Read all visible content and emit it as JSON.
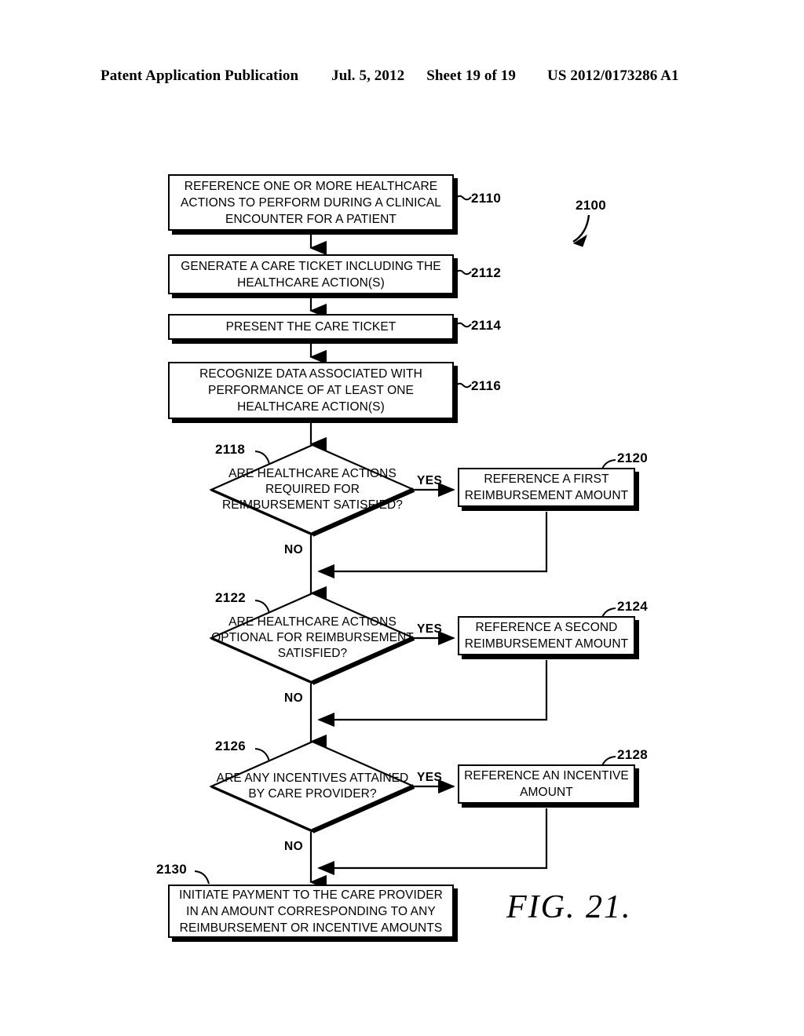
{
  "header": {
    "publication": "Patent Application Publication",
    "date": "Jul. 5, 2012",
    "sheet": "Sheet 19 of 19",
    "number": "US 2012/0173286 A1"
  },
  "figure": {
    "caption": "FIG. 21.",
    "overall_ref": "2100"
  },
  "nodes": {
    "n2110": {
      "ref": "2110",
      "text": "REFERENCE ONE OR MORE HEALTHCARE ACTIONS TO PERFORM DURING A CLINICAL ENCOUNTER FOR A PATIENT"
    },
    "n2112": {
      "ref": "2112",
      "text": "GENERATE A CARE TICKET INCLUDING THE HEALTHCARE ACTION(S)"
    },
    "n2114": {
      "ref": "2114",
      "text": "PRESENT THE CARE TICKET"
    },
    "n2116": {
      "ref": "2116",
      "text": "RECOGNIZE DATA ASSOCIATED WITH PERFORMANCE OF AT LEAST ONE HEALTHCARE ACTION(S)"
    },
    "n2118": {
      "ref": "2118",
      "text": "ARE HEALTHCARE ACTIONS REQUIRED FOR REIMBURSEMENT SATISFIED?",
      "yes": "YES",
      "no": "NO"
    },
    "n2120": {
      "ref": "2120",
      "text": "REFERENCE A FIRST REIMBURSEMENT AMOUNT"
    },
    "n2122": {
      "ref": "2122",
      "text": "ARE HEALTHCARE ACTIONS OPTIONAL FOR REIMBURSEMENT SATISFIED?",
      "yes": "YES",
      "no": "NO"
    },
    "n2124": {
      "ref": "2124",
      "text": "REFERENCE A SECOND REIMBURSEMENT AMOUNT"
    },
    "n2126": {
      "ref": "2126",
      "text": "ARE ANY INCENTIVES ATTAINED BY CARE PROVIDER?",
      "yes": "YES",
      "no": "NO"
    },
    "n2128": {
      "ref": "2128",
      "text": "REFERENCE AN INCENTIVE AMOUNT"
    },
    "n2130": {
      "ref": "2130",
      "text": "INITIATE PAYMENT TO THE CARE PROVIDER IN AN AMOUNT CORRESPONDING TO ANY REIMBURSEMENT OR INCENTIVE AMOUNTS"
    }
  }
}
